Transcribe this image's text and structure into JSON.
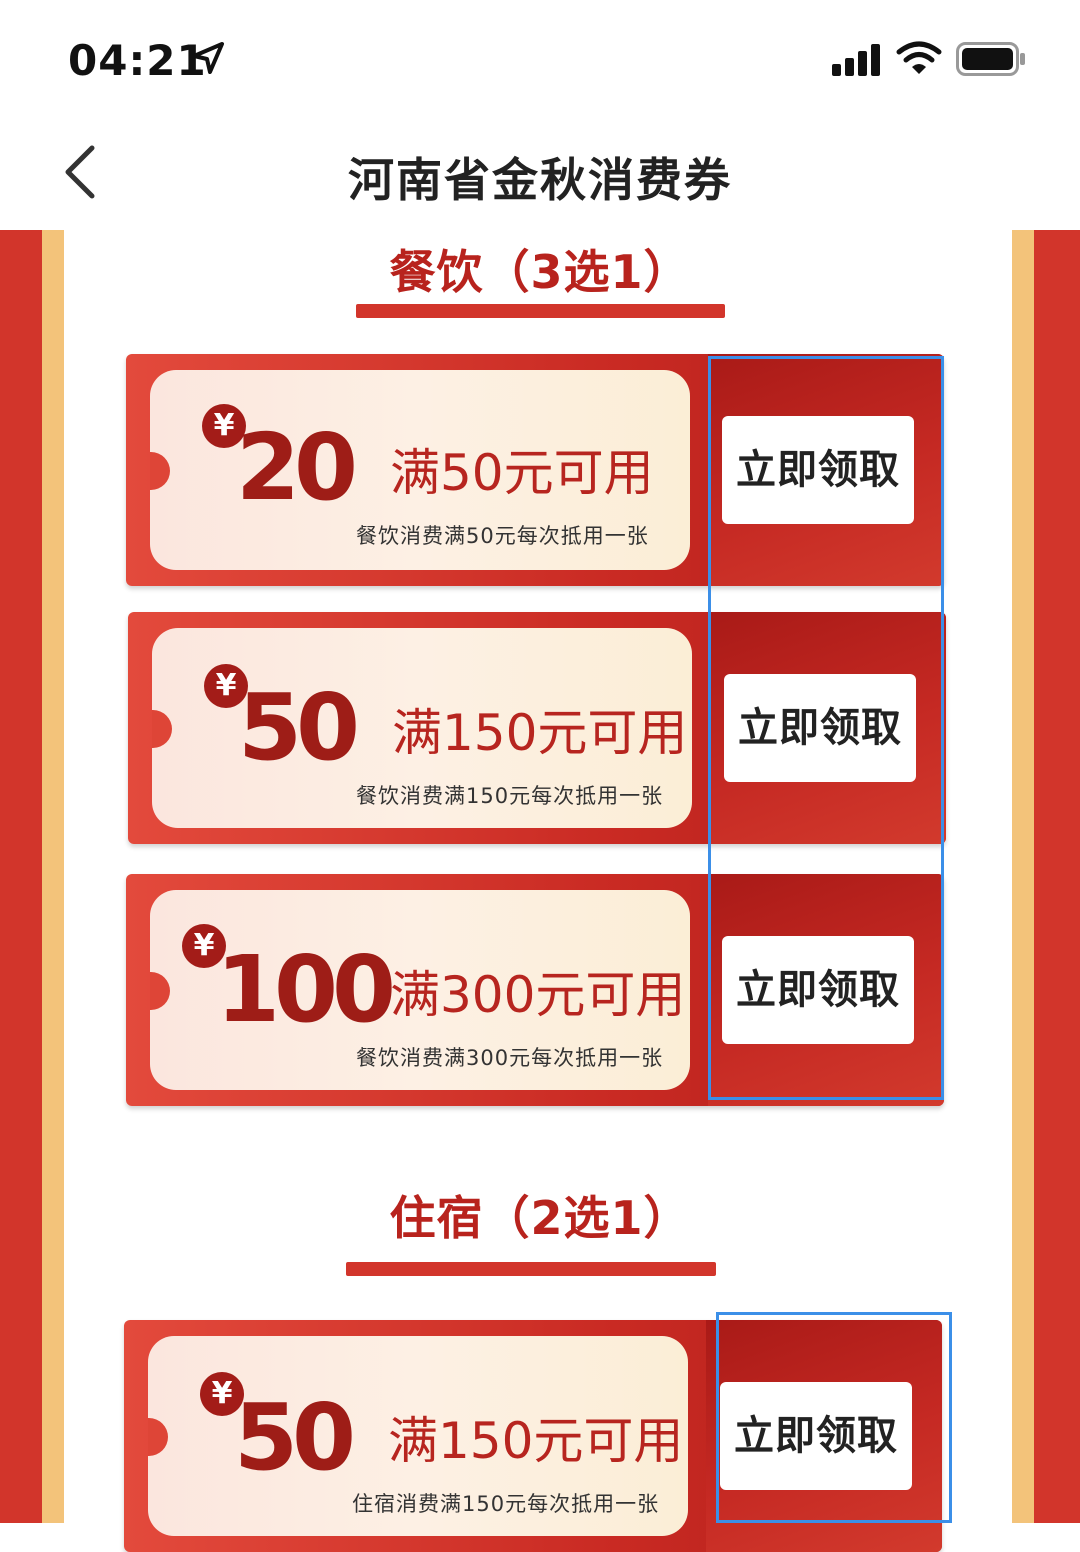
{
  "status_bar": {
    "time": "04:21"
  },
  "nav": {
    "title": "河南省金秋消费券"
  },
  "sections": [
    {
      "title": "餐饮（3选1）",
      "coupons": [
        {
          "yen": "¥",
          "amount": "20",
          "condition": "满50元可用",
          "description": "餐饮消费满50元每次抵用一张",
          "button": "立即领取"
        },
        {
          "yen": "¥",
          "amount": "50",
          "condition": "满150元可用",
          "description": "餐饮消费满150元每次抵用一张",
          "button": "立即领取"
        },
        {
          "yen": "¥",
          "amount": "100",
          "condition": "满300元可用",
          "description": "餐饮消费满300元每次抵用一张",
          "button": "立即领取"
        }
      ]
    },
    {
      "title": "住宿（2选1）",
      "coupons": [
        {
          "yen": "¥",
          "amount": "50",
          "condition": "满150元可用",
          "description": "住宿消费满150元每次抵用一张",
          "button": "立即领取"
        }
      ]
    }
  ],
  "colors": {
    "primary_red": "#d2352b",
    "gold": "#f3c37a",
    "dark_red": "#9e1d17",
    "highlight_blue": "#3b8fe8"
  }
}
